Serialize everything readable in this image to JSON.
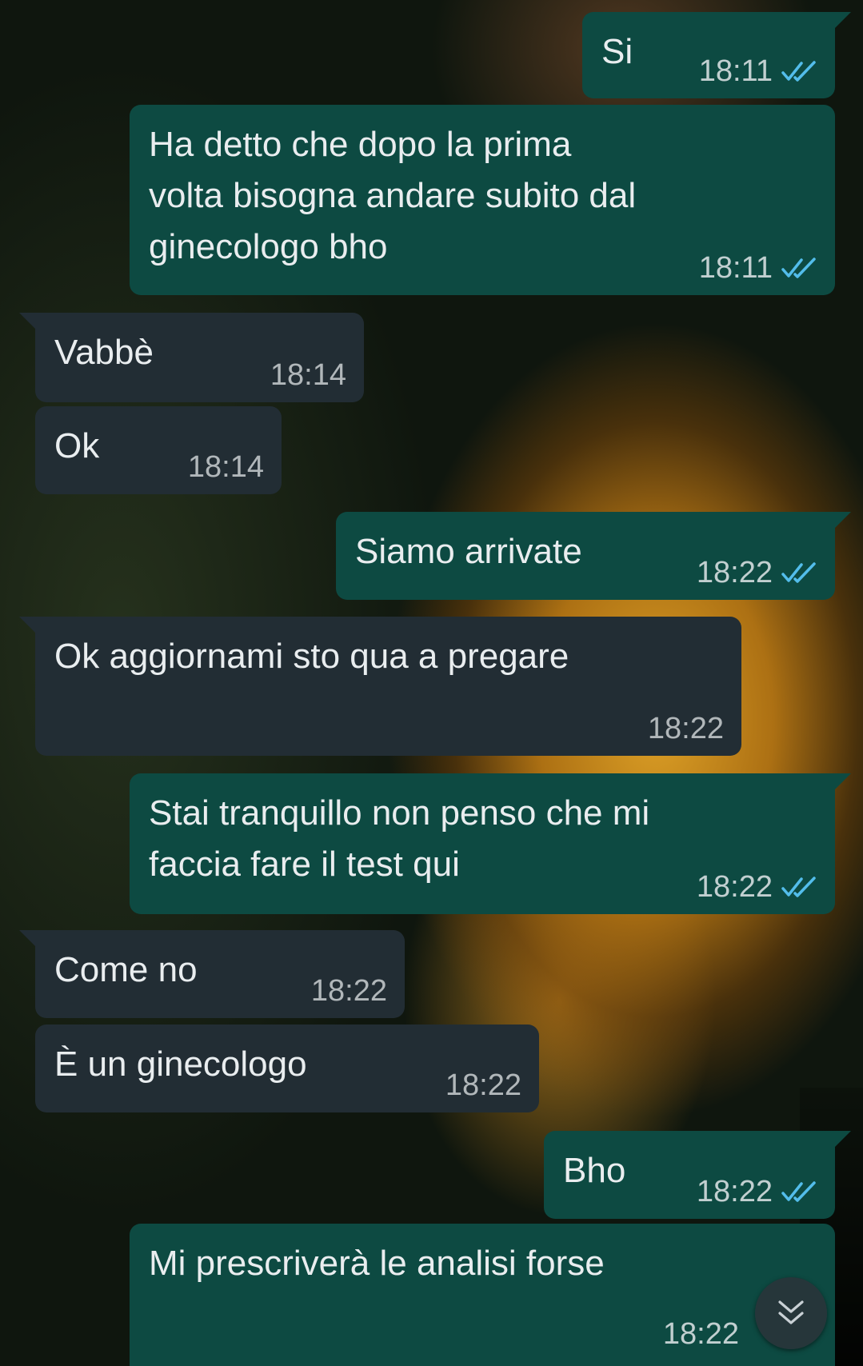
{
  "messages": [
    {
      "direction": "out",
      "text": "Si",
      "time": "18:11",
      "status": "read"
    },
    {
      "direction": "out",
      "text": "Ha detto che dopo la prima\nvolta bisogna andare subito dal\nginecologo bho",
      "time": "18:11",
      "status": "read"
    },
    {
      "direction": "in",
      "text": "Vabbè",
      "time": "18:14"
    },
    {
      "direction": "in",
      "text": "Ok",
      "time": "18:14"
    },
    {
      "direction": "out",
      "text": "Siamo arrivate",
      "time": "18:22",
      "status": "read"
    },
    {
      "direction": "in",
      "text": "Ok aggiornami sto qua a pregare",
      "time": "18:22"
    },
    {
      "direction": "out",
      "text": "Stai tranquillo non penso che mi\nfaccia fare il test qui",
      "time": "18:22",
      "status": "read"
    },
    {
      "direction": "in",
      "text": "Come no",
      "time": "18:22"
    },
    {
      "direction": "in",
      "text": "È un ginecologo",
      "time": "18:22"
    },
    {
      "direction": "out",
      "text": "Bho",
      "time": "18:22",
      "status": "read"
    },
    {
      "direction": "out",
      "text": "Mi prescriverà le analisi forse",
      "time": "18:22"
    }
  ],
  "icons": {
    "read_receipt": "double-check-icon",
    "scroll_down": "chevron-double-down-icon"
  },
  "colors": {
    "outgoing_bubble": "#0d4a42",
    "incoming_bubble": "#222d34",
    "read_tick": "#53bdeb",
    "text": "#e9edef"
  }
}
